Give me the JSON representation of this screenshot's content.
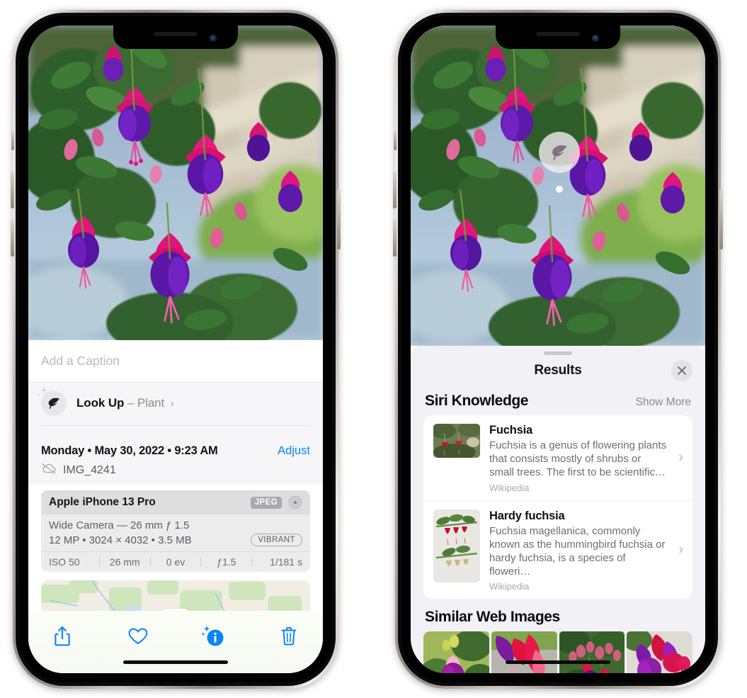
{
  "left_phone": {
    "caption": {
      "placeholder": "Add a Caption",
      "value": ""
    },
    "lookup": {
      "label": "Look Up",
      "dash": "–",
      "subject": "Plant",
      "chevron": "›",
      "icon": "leaf-icon"
    },
    "meta": {
      "date": "Monday • May 30, 2022 • 9:23 AM",
      "adjust": "Adjust",
      "filename": "IMG_4241",
      "cloud_icon": "icloud-slash-icon"
    },
    "exif": {
      "device": "Apple iPhone 13 Pro",
      "format_badge": "JPEG",
      "lens_icon": "aperture-icon",
      "lens_line": "Wide Camera — 26 mm ƒ 1.5",
      "size_line": "12 MP • 3024 × 4032 • 3.5 MB",
      "vibrant_badge": "VIBRANT",
      "stats": [
        "ISO 50",
        "26 mm",
        "0 ev",
        "ƒ1.5",
        "1/181 s"
      ]
    },
    "toolbar": [
      {
        "name": "share-button",
        "icon": "share-icon"
      },
      {
        "name": "favorite-button",
        "icon": "heart-icon"
      },
      {
        "name": "info-button",
        "icon": "info-sparkle-icon"
      },
      {
        "name": "delete-button",
        "icon": "trash-icon"
      }
    ]
  },
  "right_phone": {
    "visual_lookup_badge": {
      "icon": "leaf-icon"
    },
    "sheet": {
      "title": "Results",
      "close_label": "✕"
    },
    "siri_knowledge": {
      "title": "Siri Knowledge",
      "show_more": "Show More",
      "items": [
        {
          "title": "Fuchsia",
          "description": "Fuchsia is a genus of flowering plants that consists mostly of shrubs or small trees. The first to be scientific…",
          "source": "Wikipedia",
          "chevron": "›"
        },
        {
          "title": "Hardy fuchsia",
          "description": "Fuchsia magellanica, commonly known as the hummingbird fuchsia or hardy fuchsia, is a species of floweri…",
          "source": "Wikipedia",
          "chevron": "›"
        }
      ]
    },
    "similar_web_images": {
      "title": "Similar Web Images",
      "count": 4
    }
  },
  "colors": {
    "accent_blue": "#0a84ff",
    "sheet_bg": "#f2f1f6",
    "card_bg": "#ffffff",
    "secondary_text": "#8a8a90",
    "exif_bg": "#ececed"
  }
}
